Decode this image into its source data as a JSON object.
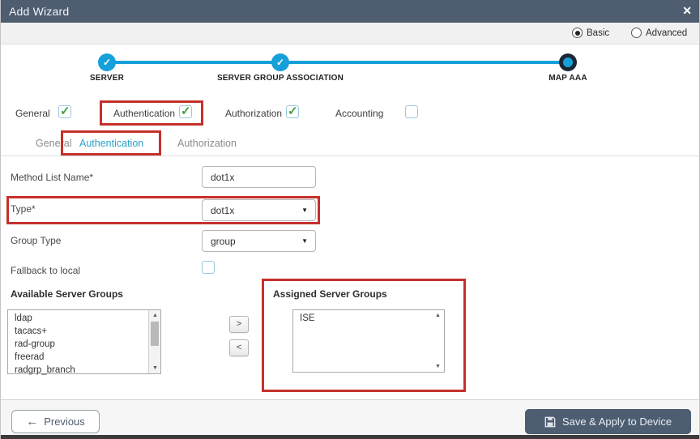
{
  "window": {
    "title": "Add Wizard"
  },
  "icons": {
    "close": "✕",
    "check": "✓",
    "caret": "▼",
    "arrow_left": "←",
    "scroll_up": "▲",
    "scroll_down": "▼",
    "move_right": ">",
    "move_left": "<"
  },
  "mode": {
    "basic": {
      "label": "Basic",
      "selected": true
    },
    "advanced": {
      "label": "Advanced",
      "selected": false
    }
  },
  "stepper": {
    "steps": [
      {
        "label": "SERVER",
        "state": "complete"
      },
      {
        "label": "SERVER GROUP ASSOCIATION",
        "state": "complete"
      },
      {
        "label": "MAP AAA",
        "state": "current"
      }
    ]
  },
  "toggles": [
    {
      "label": "General",
      "checked": true,
      "highlighted": false
    },
    {
      "label": "Authentication",
      "checked": true,
      "highlighted": true
    },
    {
      "label": "Authorization",
      "checked": true,
      "highlighted": false
    },
    {
      "label": "Accounting",
      "checked": false,
      "highlighted": false
    }
  ],
  "tabs": [
    {
      "label": "General",
      "active": false
    },
    {
      "label": "Authentication",
      "active": true,
      "highlighted": true
    },
    {
      "label": "Authorization",
      "active": false
    }
  ],
  "form": {
    "method_list_name": {
      "label": "Method List Name*",
      "value": "dot1x"
    },
    "type": {
      "label": "Type*",
      "value": "dot1x",
      "highlighted": true
    },
    "group_type": {
      "label": "Group Type",
      "value": "group"
    },
    "fallback": {
      "label": "Fallback to local",
      "checked": false
    }
  },
  "groups": {
    "available_label": "Available Server Groups",
    "assigned_label": "Assigned Server Groups",
    "available": [
      "ldap",
      "tacacs+",
      "rad-group",
      "freerad",
      "radgrp_branch"
    ],
    "assigned": [
      "ISE"
    ],
    "assigned_highlighted": true
  },
  "footer": {
    "previous": "Previous",
    "save": "Save & Apply to Device"
  },
  "colors": {
    "titlebar": "#4e5d70",
    "accent_blue": "#16a0da",
    "highlight_red": "#c5312b",
    "tab_active": "#2ba1c8",
    "check_green": "#3fa33f",
    "save_button": "#4d5d72"
  }
}
